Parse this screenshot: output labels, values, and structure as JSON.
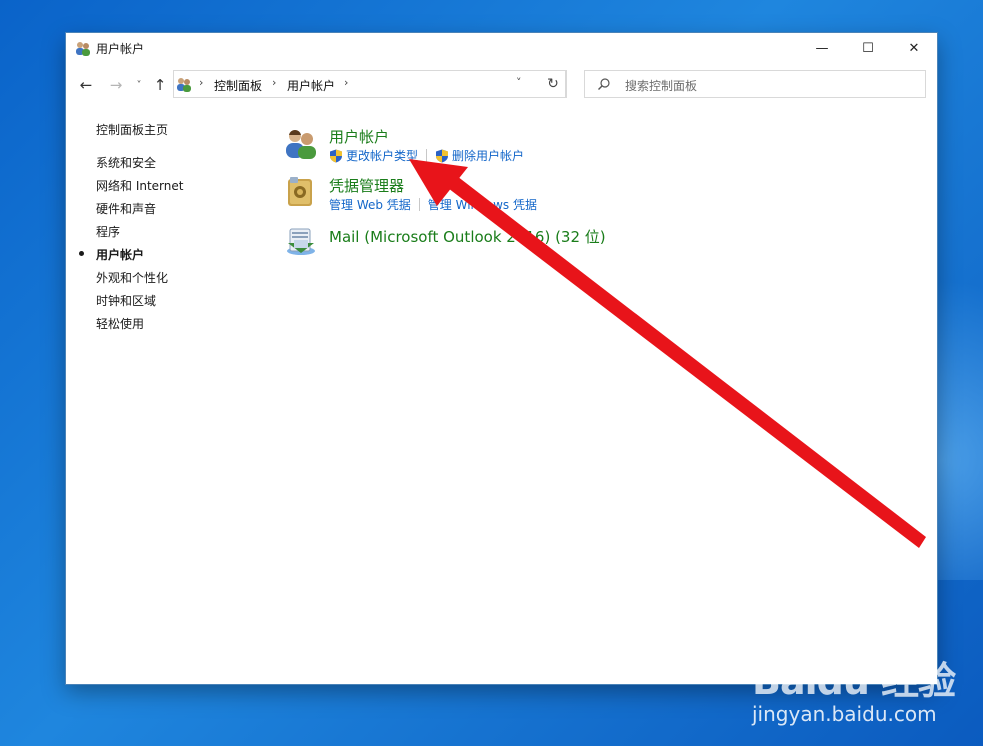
{
  "window": {
    "title": "用户帐户",
    "controls": {
      "minimize": "—",
      "maximize": "☐",
      "close": "✕"
    }
  },
  "navigation": {
    "back": "←",
    "forward": "→",
    "recent": "˅",
    "up": "↑",
    "breadcrumb": [
      "控制面板",
      "用户帐户"
    ],
    "separator": "›",
    "dropdown": "˅",
    "refresh": "↻"
  },
  "search": {
    "placeholder": "搜索控制面板"
  },
  "sidebar": {
    "home": "控制面板主页",
    "items": [
      "系统和安全",
      "网络和 Internet",
      "硬件和声音",
      "程序",
      "用户帐户",
      "外观和个性化",
      "时钟和区域",
      "轻松使用"
    ],
    "current": "用户帐户"
  },
  "categories": [
    {
      "title": "用户帐户",
      "icon": "users-icon",
      "links": [
        "更改帐户类型",
        "删除用户帐户"
      ]
    },
    {
      "title": "凭据管理器",
      "icon": "credential-vault-icon",
      "links": [
        "管理 Web 凭据",
        "管理 Windows 凭据"
      ]
    },
    {
      "title": "Mail (Microsoft Outlook 2016) (32 位)",
      "icon": "mail-icon",
      "links": []
    }
  ],
  "annotation": {
    "color": "#e8141a",
    "type": "red-arrow",
    "points_to": "更改帐户类型"
  },
  "watermark": {
    "logo": "Baidu 经验",
    "url": "jingyan.baidu.com"
  },
  "colors": {
    "category_title": "#1a7d1a",
    "link": "#1366c9",
    "desktop": "#1a78d6"
  }
}
